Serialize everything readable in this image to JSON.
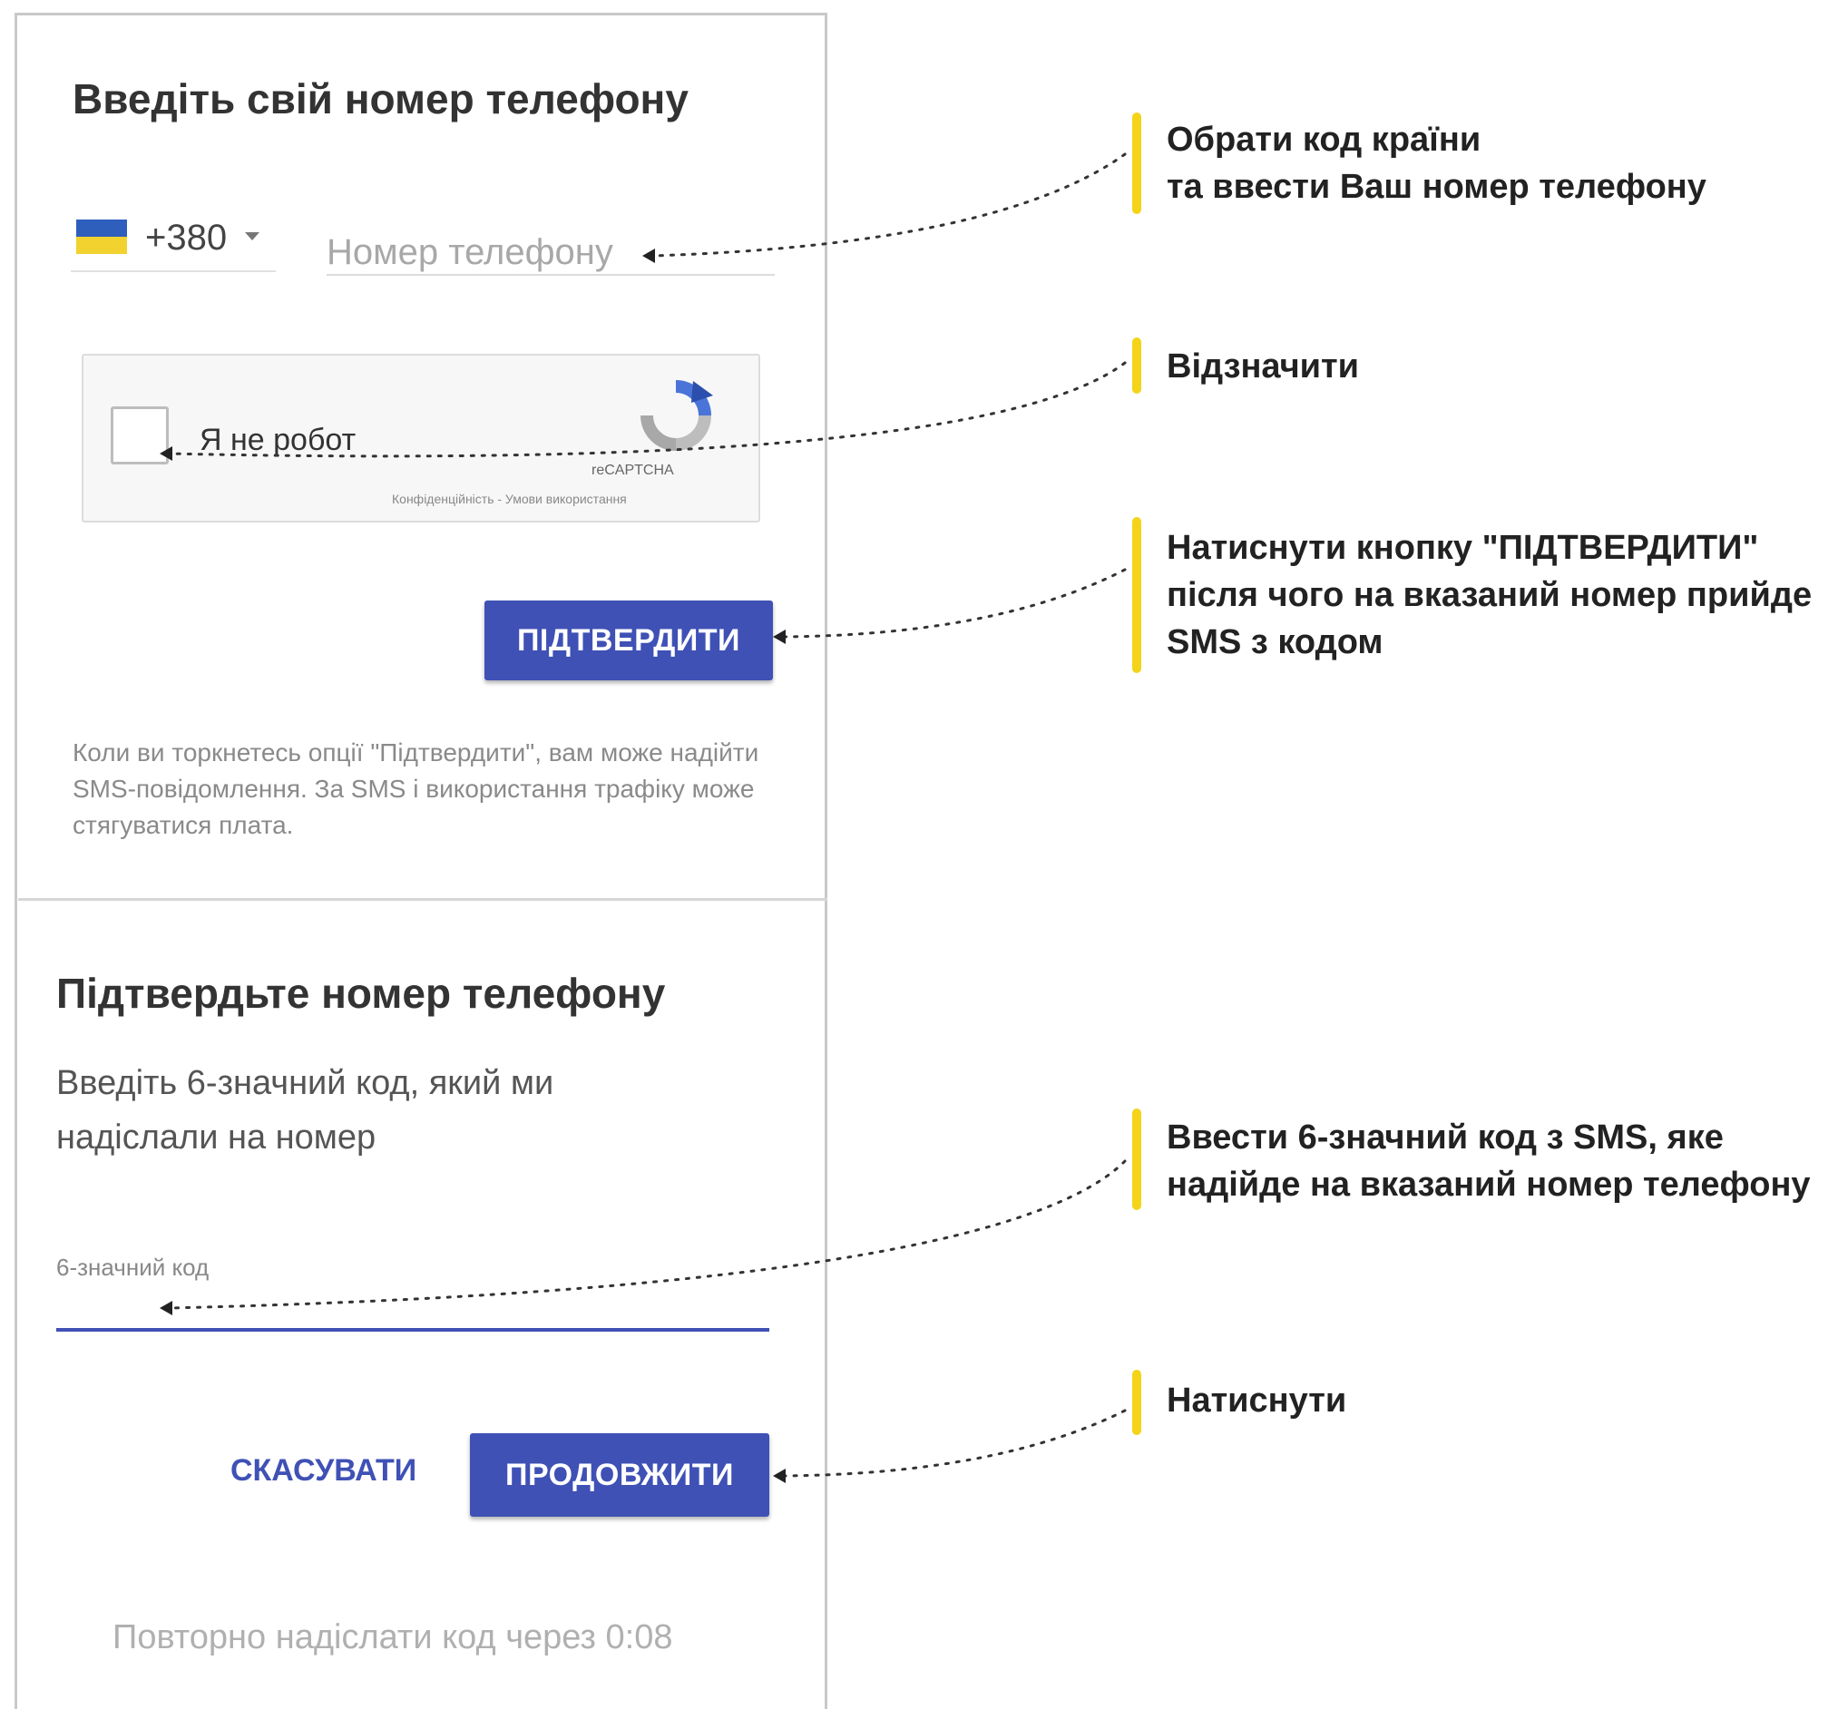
{
  "screen1": {
    "title": "Введіть свій номер телефону",
    "country_code": "+380",
    "phone_placeholder": "Номер телефону",
    "captcha": {
      "label": "Я не робот",
      "brand": "reCAPTCHA",
      "links": "Конфіденційність - Умови використання"
    },
    "confirm_label": "ПІДТВЕРДИТИ",
    "note": "Коли ви торкнетесь опції \"Підтвердити\", вам може надійти SMS-повідомлення. За SMS і використання трафіку може стягуватися плата."
  },
  "screen2": {
    "title": "Підтвердьте номер телефону",
    "subtitle": "Введіть 6-значний код, який ми надіслали на номер",
    "code_label": "6-значний код",
    "cancel_label": "СКАСУВАТИ",
    "continue_label": "ПРОДОВЖИТИ",
    "resend": "Повторно надіслати код через 0:08"
  },
  "annotations": [
    "Обрати код країни\nта ввести Ваш номер телефону",
    "Відзначити",
    "Натиснути кнопку \"ПІДТВЕРДИТИ\"\nпісля чого на вказаний номер прийде\nSMS з кодом",
    "Ввести 6-значний код з SMS, яке\nнадійде на вказаний номер телефону",
    "Натиснути"
  ],
  "colors": {
    "primary": "#3f51b5",
    "highlight": "#f4d419",
    "flag_blue": "#2f5fbd",
    "flag_yellow": "#f2d22e"
  },
  "icons": [
    "ukraine-flag-icon",
    "chevron-down-icon",
    "recaptcha-logo-icon",
    "arrow-pointer-icon"
  ]
}
